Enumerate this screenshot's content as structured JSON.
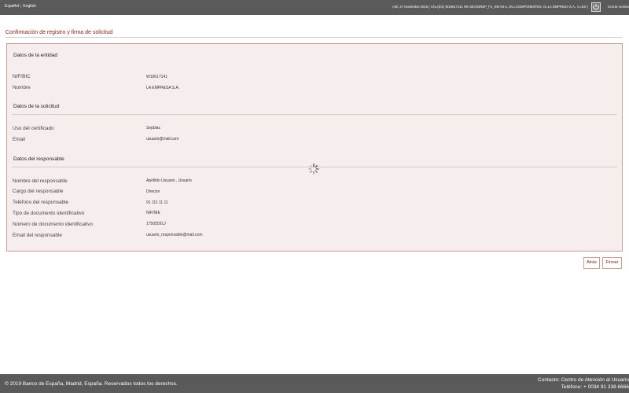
{
  "topbar": {
    "lang_es": "Español",
    "lang_sep": "|",
    "lang_en": "English",
    "session_info": "mié, 27 noviembre 2019 ( CN=(EG) W19617141 RE-SEA03REP_PJ_SW 00-1, OU=COMPONENTES, O=LA EMPRESA S.A., C=ES )",
    "logout_icon": "logout-icon",
    "logout_label": "Cerrar sesión"
  },
  "page": {
    "title": "Confirmación de registro y firma de solicitud"
  },
  "entity": {
    "title": "Datos de la entidad",
    "nif_label": "NIF/BIC",
    "nif_value": "W19617141",
    "name_label": "Nombre",
    "name_value": "LA EMPRESA S.A."
  },
  "request": {
    "title": "Datos de la solicitud",
    "usage_label": "Uso del certificado",
    "usage_value": "Sepblac",
    "email_label": "Email",
    "email_value": "usuario@mail.com"
  },
  "responsible": {
    "title": "Datos del responsable",
    "name_label": "Nombre del responsable",
    "name_value": "Apellido Usuario , Usuario",
    "position_label": "Cargo del responsable",
    "position_value": "Director",
    "phone_label": "Teléfono del responsable",
    "phone_value": "91 111 11 11",
    "doctype_label": "Tipo de documento identificativo",
    "doctype_value": "NIF/NIE",
    "docnum_label": "Número de documento identificativo",
    "docnum_value": "17505591J",
    "email_label": "Email del responsable",
    "email_value": "usuario_responsable@mail.com"
  },
  "actions": {
    "back_label": "Atrás",
    "sign_label": "Firmar"
  },
  "footer": {
    "copyright": "© 2019 Banco de España, Madrid, España. Reservados todos los derechos.",
    "contact_line1": "Contacto: Centro de Atención al Usuario",
    "contact_line2": "Teléfono: + 0034 91 338 6666"
  },
  "colors": {
    "accent": "#8b1a10",
    "panel_bg": "#f6eeed",
    "bar_bg": "#5a5a5a"
  }
}
